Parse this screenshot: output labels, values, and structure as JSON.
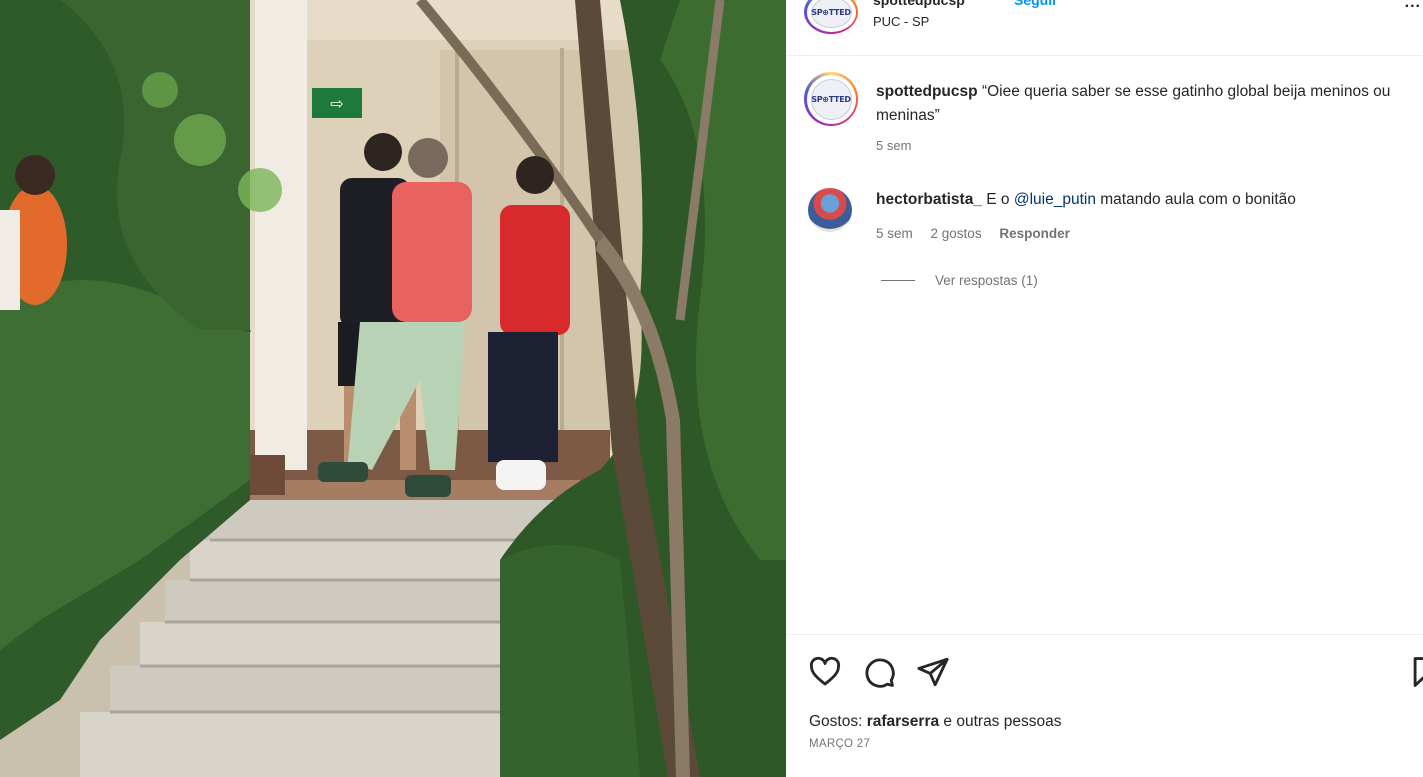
{
  "post": {
    "author": "spottedpucsp",
    "follow_label": "Seguir",
    "location": "PUC - SP",
    "more_label": "...",
    "avatar_logo_text": "SP⊕TTED"
  },
  "caption": {
    "username": "spottedpucsp",
    "text": "“Oiee queria saber se esse gatinho global beija meninos ou meninas”",
    "time": "5 sem"
  },
  "comment": {
    "username": "hectorbatista_",
    "text_before": " E o ",
    "mention": "@luie_putin",
    "text_after": " matando aula com o bonitão",
    "time": "5 sem",
    "likes": "2 gostos",
    "reply_label": "Responder",
    "view_replies": "Ver respostas (1)"
  },
  "actions": {
    "icons": [
      "heart-icon",
      "comment-icon",
      "share-icon",
      "bookmark-icon"
    ],
    "likes_prefix": "Gostos: ",
    "likes_user": "rafarserra",
    "likes_suffix": " e outras pessoas",
    "date": "MARÇO 27"
  },
  "colors": {
    "link_blue": "#0095f6",
    "mention_blue": "#00376b",
    "muted_text": "#737373",
    "primary_text": "#262626",
    "divider": "#efefef"
  }
}
